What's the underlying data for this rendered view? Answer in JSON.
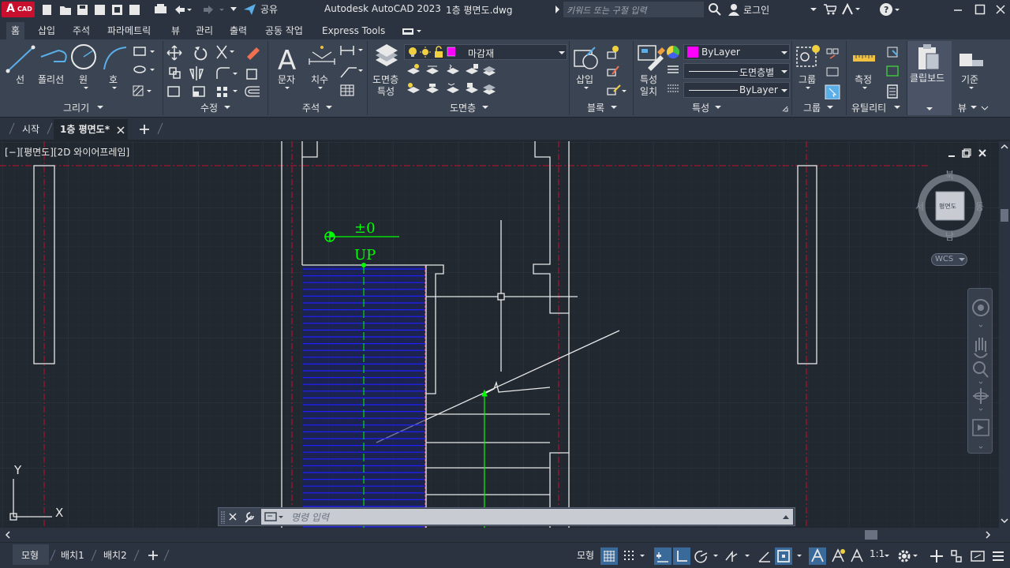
{
  "titlebar": {
    "app_badge": "A",
    "app_badge_sub": "CAD",
    "share_label": "공유",
    "title": "Autodesk AutoCAD 2023",
    "filename": "1층 평면도.dwg",
    "search_placeholder": "키워드 또는 구절 입력",
    "login_label": "로그인"
  },
  "ribbon_tabs": [
    "홈",
    "삽입",
    "주석",
    "파라메트릭",
    "뷰",
    "관리",
    "출력",
    "공동 작업",
    "Express Tools"
  ],
  "panels": {
    "draw": {
      "label": "그리기",
      "tools": [
        "선",
        "폴리선",
        "원",
        "호"
      ]
    },
    "modify": {
      "label": "수정"
    },
    "annotation": {
      "label": "주석",
      "tools": [
        "문자",
        "치수"
      ]
    },
    "layers": {
      "label": "도면층",
      "tool": "도면층\n특성",
      "tool_line1": "도면층",
      "tool_line2": "특성",
      "current_layer": "마감재",
      "layer_color": "#ff00ff"
    },
    "block": {
      "label": "블록",
      "tool": "삽입"
    },
    "properties": {
      "label": "특성",
      "tool_line1": "특성",
      "tool_line2": "일치",
      "color_value": "ByLayer",
      "linetype_value": "도면층별",
      "lineweight_value": "ByLayer"
    },
    "groups": {
      "label": "그룹",
      "tool": "그룹"
    },
    "utilities": {
      "label": "유틸리티",
      "tool": "측정"
    },
    "clipboard": {
      "label": "클립보드"
    },
    "view": {
      "label": "뷰",
      "tool": "기준"
    }
  },
  "doc_tabs": {
    "start": "시작",
    "active": "1층 평면도*"
  },
  "viewport": {
    "label": "[−][평면도][2D 와이어프레임]",
    "annotation_level": "±0",
    "annotation_up": "UP",
    "viewcube": {
      "north": "북",
      "south": "남",
      "west": "서",
      "east": "동",
      "face": "평면도",
      "wcs": "WCS"
    },
    "ucs_x": "X",
    "ucs_y": "Y"
  },
  "command_line": {
    "placeholder": "명령 입력"
  },
  "layout_tabs": [
    "모형",
    "배치1",
    "배치2"
  ],
  "statusbar": {
    "model": "모형",
    "scale": "1:1"
  },
  "colors": {
    "accent_red": "#c8102e",
    "hatch_blue": "#2020ff",
    "green": "#00ff00",
    "canvas_bg": "#212830"
  }
}
